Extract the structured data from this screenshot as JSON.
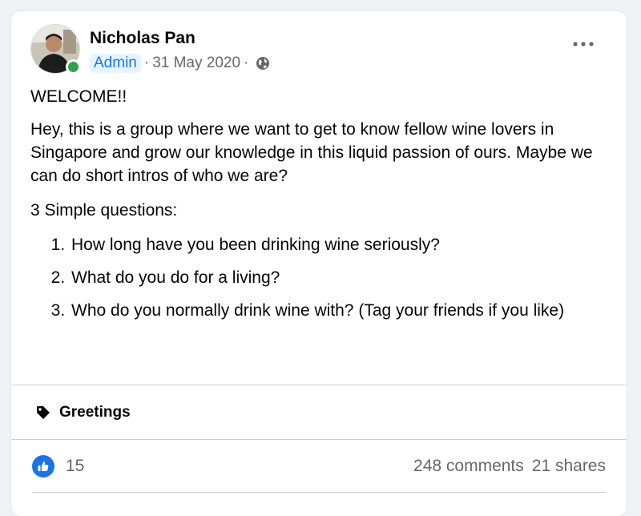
{
  "post": {
    "author": "Nicholas Pan",
    "role_badge": "Admin",
    "separator": "·",
    "date": "31 May 2020",
    "privacy_icon": "globe-icon",
    "more_icon": "more-options-icon",
    "title_line": "WELCOME!!",
    "intro": "Hey, this is a group where we want to get to know fellow wine lovers in Singapore and grow our knowledge in this liquid passion of ours. Maybe we can do short intros of who we are?",
    "questions_heading": "3 Simple questions:",
    "questions": [
      "How long have you been drinking wine seriously?",
      "What do you do for a living?",
      "Who do you normally drink wine with? (Tag your friends if you like)"
    ],
    "topic": "Greetings",
    "topic_icon": "tag-icon",
    "reactions": {
      "icon": "like-icon",
      "count": "15"
    },
    "comments": "248 comments",
    "shares": "21 shares"
  },
  "colors": {
    "background": "#f0f2f5",
    "card": "#ffffff",
    "accent": "#1877f2",
    "badge_bg": "#e7f3ff",
    "online": "#31a24c",
    "secondary_text": "#65676b"
  }
}
